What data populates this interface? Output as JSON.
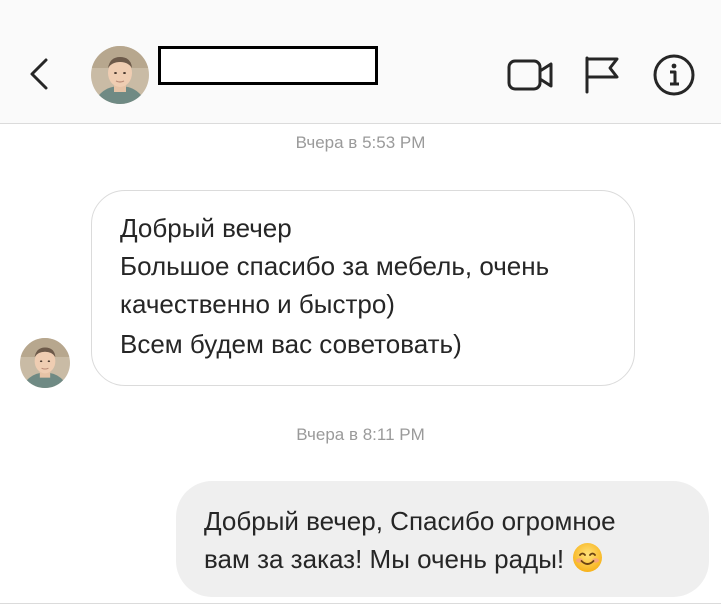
{
  "header": {
    "back_icon": "chevron-left-icon",
    "contact_name": "",
    "video_icon": "video-camera-icon",
    "flag_icon": "flag-icon",
    "info_icon": "info-icon"
  },
  "thread": {
    "timestamp_1": "Вчера в 5:53 PM",
    "incoming_message": {
      "lines": [
        "Добрый вечер",
        "Большое спасибо за мебель, очень",
        "качественно и быстро)",
        "Всем будем вас советовать)"
      ]
    },
    "timestamp_2": "Вчера в 8:11 PM",
    "outgoing_message": {
      "lines": [
        "Добрый вечер, Спасибо огромное",
        "вам за заказ! Мы очень рады!"
      ],
      "emoji": "smiling-face-icon"
    }
  },
  "colors": {
    "header_bg": "#fafafa",
    "text": "#262626",
    "timestamp": "#9a9a9a",
    "bubble_border": "#dbdbdb",
    "outgoing_bubble": "#efefef"
  }
}
